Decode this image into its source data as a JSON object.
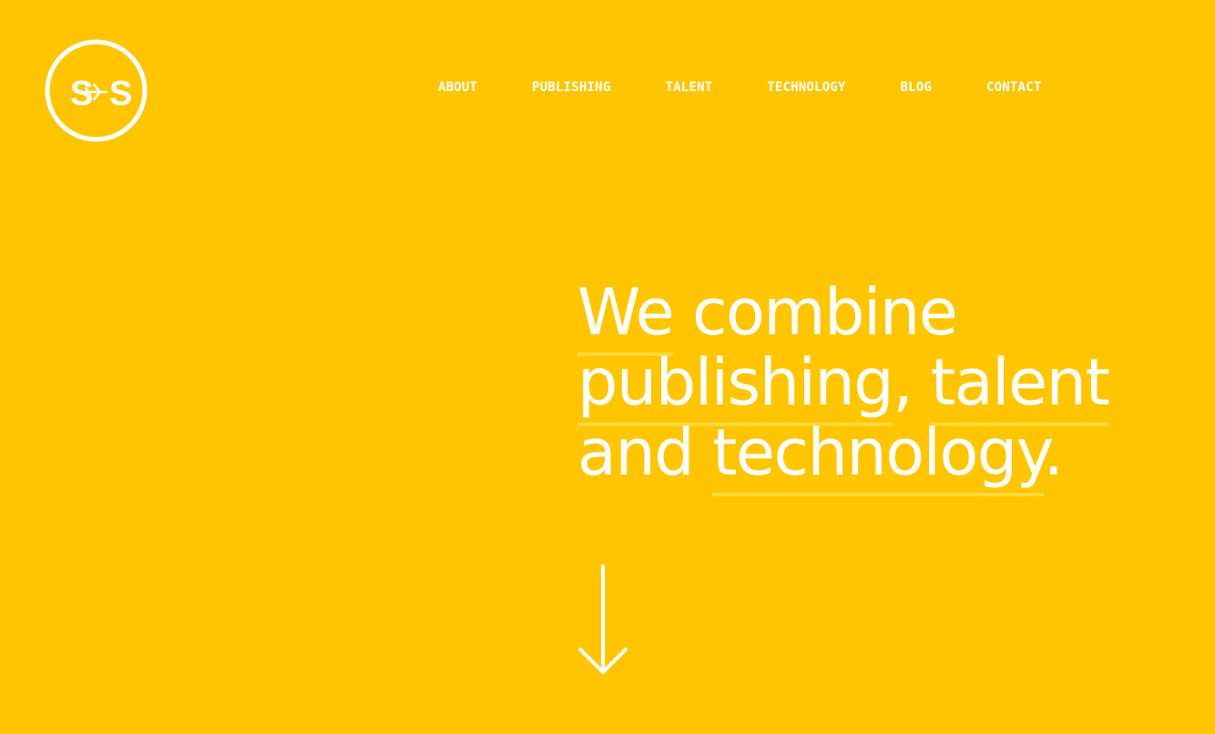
{
  "brand": {
    "logo_text_left": "S",
    "logo_text_right": "S",
    "logo_icon": "airplane-icon"
  },
  "nav": {
    "items": [
      {
        "label": "ABOUT"
      },
      {
        "label": "PUBLISHING"
      },
      {
        "label": "TALENT"
      },
      {
        "label": "TECHNOLOGY"
      },
      {
        "label": "BLOG"
      },
      {
        "label": "CONTACT"
      }
    ]
  },
  "hero": {
    "headline": {
      "word_we": "We",
      "word_combine": "combine",
      "publishing": "publishing",
      "comma": ",",
      "talent": "talent",
      "and": "and",
      "technology": "technology",
      "period": "."
    },
    "scroll_icon": "arrow-down-icon"
  },
  "colors": {
    "background": "#FFC600",
    "text": "#FFFFFF",
    "underline": "#FFD83B"
  }
}
